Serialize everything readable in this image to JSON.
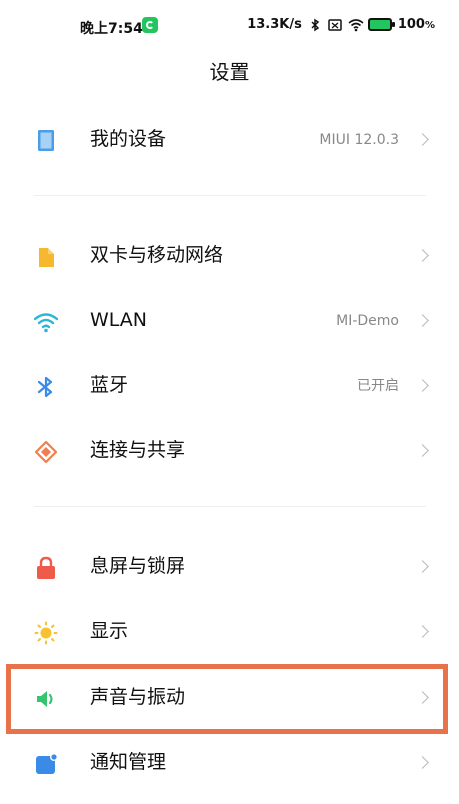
{
  "status_bar": {
    "time": "晚上7:54",
    "network_speed": "13.3K/s",
    "battery": "100",
    "battery_unit": "%"
  },
  "header": {
    "title": "设置"
  },
  "items": [
    {
      "id": "my-device",
      "label": "我的设备",
      "value": "MIUI 12.0.3",
      "icon": "device-icon",
      "color": "#4a9ee8"
    },
    {
      "id": "dual-sim",
      "label": "双卡与移动网络",
      "value": "",
      "icon": "sim-card-icon",
      "color": "#f5b82e"
    },
    {
      "id": "wlan",
      "label": "WLAN",
      "value": "MI-Demo",
      "icon": "wifi-icon",
      "color": "#2bb5d9"
    },
    {
      "id": "bluetooth",
      "label": "蓝牙",
      "value": "已开启",
      "icon": "bluetooth-icon",
      "color": "#3a8be8"
    },
    {
      "id": "connection-sharing",
      "label": "连接与共享",
      "value": "",
      "icon": "connection-icon",
      "color": "#f07f4d"
    },
    {
      "id": "lock-screen",
      "label": "息屏与锁屏",
      "value": "",
      "icon": "lock-icon",
      "color": "#ef5b4a"
    },
    {
      "id": "display",
      "label": "显示",
      "value": "",
      "icon": "sun-icon",
      "color": "#f7c12f"
    },
    {
      "id": "sound-vibration",
      "label": "声音与振动",
      "value": "",
      "icon": "speaker-icon",
      "color": "#35c46f"
    },
    {
      "id": "notifications",
      "label": "通知管理",
      "value": "",
      "icon": "notification-icon",
      "color": "#3a8be8"
    }
  ],
  "highlight_color": "#e8734a"
}
